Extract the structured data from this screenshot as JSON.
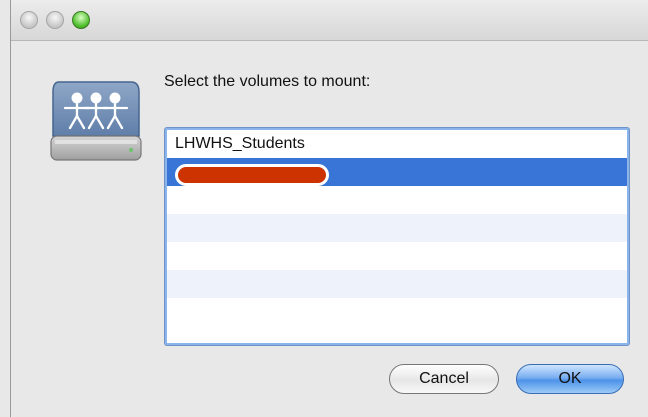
{
  "dialog": {
    "prompt": "Select the volumes to mount:",
    "volumes": [
      {
        "label": "LHWHS_Students",
        "selected": false
      },
      {
        "label": "",
        "selected": true,
        "redacted": true
      },
      {
        "label": "",
        "selected": false
      },
      {
        "label": "",
        "selected": false
      },
      {
        "label": "",
        "selected": false
      },
      {
        "label": "",
        "selected": false
      },
      {
        "label": "",
        "selected": false
      }
    ],
    "cancel_label": "Cancel",
    "ok_label": "OK"
  },
  "icons": {
    "drive": "network-drive-icon"
  },
  "colors": {
    "selection": "#3875d7",
    "redaction": "#cc3300",
    "ok_button": "#4d92ea"
  }
}
